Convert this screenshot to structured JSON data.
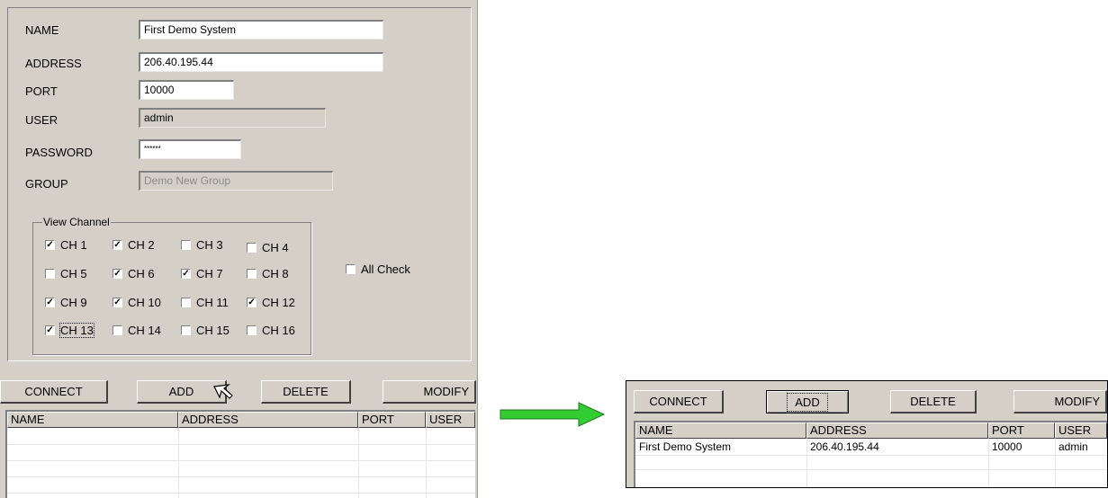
{
  "form": {
    "name_label": "NAME",
    "name_value": "First Demo System",
    "address_label": "ADDRESS",
    "address_value": "206.40.195.44",
    "port_label": "PORT",
    "port_value": "10000",
    "user_label": "USER",
    "user_value": "admin",
    "password_label": "PASSWORD",
    "password_value": "******",
    "group_label": "GROUP",
    "group_value": "Demo New Group"
  },
  "view_channel": {
    "title": "View Channel",
    "channels": [
      {
        "label": "CH 1",
        "checked": true
      },
      {
        "label": "CH 2",
        "checked": true
      },
      {
        "label": "CH 3",
        "checked": false
      },
      {
        "label": "CH 4",
        "checked": false
      },
      {
        "label": "CH 5",
        "checked": false
      },
      {
        "label": "CH 6",
        "checked": true
      },
      {
        "label": "CH 7",
        "checked": true
      },
      {
        "label": "CH 8",
        "checked": false
      },
      {
        "label": "CH 9",
        "checked": true
      },
      {
        "label": "CH 10",
        "checked": true
      },
      {
        "label": "CH 11",
        "checked": false
      },
      {
        "label": "CH 12",
        "checked": true
      },
      {
        "label": "CH 13",
        "checked": true
      },
      {
        "label": "CH 14",
        "checked": false
      },
      {
        "label": "CH 15",
        "checked": false
      },
      {
        "label": "CH 16",
        "checked": false
      }
    ],
    "all_check_label": "All Check",
    "all_check_checked": false
  },
  "buttons": {
    "connect": "CONNECT",
    "add": "ADD",
    "delete": "DELETE",
    "modify": "MODIFY"
  },
  "table": {
    "headers": [
      "NAME",
      "ADDRESS",
      "PORT",
      "USER"
    ],
    "rows_after": [
      [
        "First Demo System",
        "206.40.195.44",
        "10000",
        "admin"
      ]
    ]
  },
  "colors": {
    "arrow": "#33cc33",
    "panel": "#d4d0c8"
  }
}
